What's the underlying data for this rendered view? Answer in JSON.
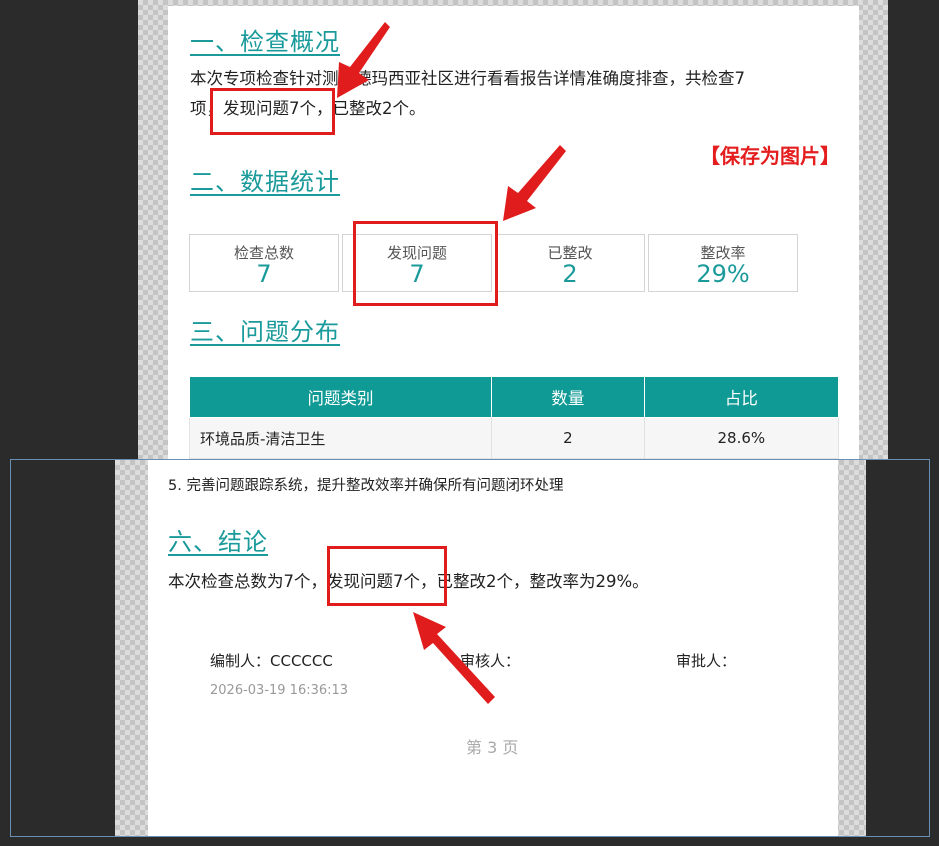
{
  "report": {
    "section1": {
      "title": "一、检查概况",
      "text_line1": "本次专项检查针对测试德玛西亚社区进行看看报告详情准确度排查，共检查7",
      "text_line2": "项，发现问题7个，已整改2个。"
    },
    "save_as_image": "【保存为图片】",
    "section2": {
      "title": "二、数据统计",
      "stats": [
        {
          "label": "检查总数",
          "value": "7"
        },
        {
          "label": "发现问题",
          "value": "7"
        },
        {
          "label": "已整改",
          "value": "2"
        },
        {
          "label": "整改率",
          "value": "29%"
        }
      ]
    },
    "section3": {
      "title": "三、问题分布",
      "table": {
        "headers": [
          "问题类别",
          "数量",
          "占比"
        ],
        "rows": [
          {
            "category": "环境品质-清洁卫生",
            "count": "2",
            "ratio": "28.6%"
          }
        ]
      }
    }
  },
  "popup": {
    "suggestion5": "5. 完善问题跟踪系统，提升整改效率并确保所有问题闭环处理",
    "section6_title": "六、结论",
    "conclusion": "本次检查总数为7个，发现问题7个，已整改2个，整改率为29%。",
    "editor": "编制人：CCCCCC",
    "reviewer": "审核人：",
    "approver": "审批人：",
    "timestamp": "2026-03-19 16:36:13",
    "page_number": "第 3 页"
  },
  "colors": {
    "accent_teal": "#1a9a9a",
    "table_header": "#0f9a95",
    "annotation_red": "#e01c1c"
  }
}
